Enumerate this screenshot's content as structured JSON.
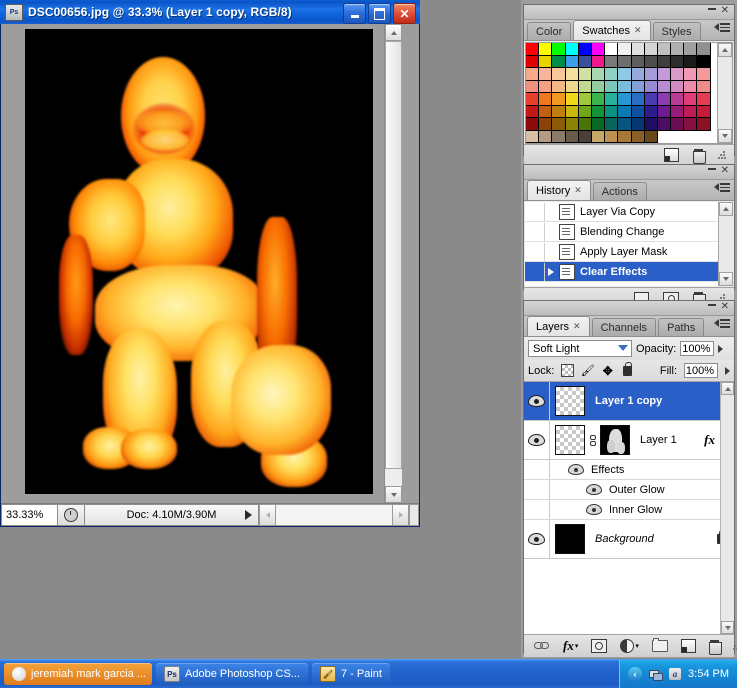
{
  "document_window": {
    "title": "DSC00656.jpg @ 33.3% (Layer 1 copy, RGB/8)",
    "app_icon": "photoshop-icon",
    "minimize_label": "_",
    "maximize_label": "□",
    "close_label": "✕",
    "status": {
      "zoom": "33.33%",
      "doc_info": "Doc: 4.10M/3.90M"
    }
  },
  "swatches_panel": {
    "tabs": [
      {
        "label": "Color",
        "active": false,
        "closable": false
      },
      {
        "label": "Swatches",
        "active": true,
        "closable": true
      },
      {
        "label": "Styles",
        "active": false,
        "closable": false
      }
    ],
    "close_x": "✕",
    "swatch_rows": [
      [
        "#ff0000",
        "#ffff00",
        "#00ff00",
        "#00ffff",
        "#0000ff",
        "#ff00ff",
        "#ffffff",
        "#f0f0f0",
        "#e0e0e0",
        "#d4d4d4",
        "#c0c0c0",
        "#b0b0b0",
        "#a0a0a0",
        "#909090"
      ],
      [
        "#e00000",
        "#e8d400",
        "#008c4a",
        "#3ba0e8",
        "#3a4f9e",
        "#f0188c",
        "#7a7a7a",
        "#6e6e6e",
        "#5e5e5e",
        "#4e4e4e",
        "#3e3e3e",
        "#2e2e2e",
        "#1a1a1a",
        "#000000"
      ],
      [
        "#f8a98a",
        "#f6b49a",
        "#f6c79a",
        "#f3e09c",
        "#cfe0a0",
        "#a8d7b0",
        "#8fd2c4",
        "#8fc8e2",
        "#96aade",
        "#a59bd8",
        "#c39bd8",
        "#d89bc8",
        "#f09ab4",
        "#f29a9a"
      ],
      [
        "#f29080",
        "#f2a184",
        "#f2b884",
        "#eed88c",
        "#c2d88e",
        "#95ce9e",
        "#79c8bb",
        "#79bcdc",
        "#839ed8",
        "#968bd2",
        "#b88bd2",
        "#d28bc0",
        "#ec8aa8",
        "#ee8a8a"
      ],
      [
        "#e8402c",
        "#f07820",
        "#f09820",
        "#f2d81c",
        "#9ec83c",
        "#3cb44c",
        "#28b29a",
        "#2896d2",
        "#2a6ec4",
        "#4a3cb0",
        "#8a3cb0",
        "#b83c96",
        "#e03c78",
        "#e43c52"
      ],
      [
        "#c41818",
        "#c06010",
        "#c08010",
        "#c8b810",
        "#6ea818",
        "#149438",
        "#0c9280",
        "#0c78b4",
        "#1050a4",
        "#2c1c90",
        "#6c1c90",
        "#981c78",
        "#c01c58",
        "#c41c38"
      ],
      [
        "#8c0a0a",
        "#8a4208",
        "#8a5c08",
        "#8c8208",
        "#4a7408",
        "#086824",
        "#066458",
        "#065480",
        "#083874",
        "#1e0e64",
        "#4c0e64",
        "#6c0e54",
        "#88103e",
        "#8c1026"
      ],
      [
        "#d9bfa4",
        "#b49a82",
        "#8a7a68",
        "#6a5a4a",
        "#4a4038",
        "#c8a868",
        "#c09050",
        "#a87838",
        "#8a6028",
        "#6a4818",
        "",
        "",
        "",
        ""
      ]
    ],
    "footer_buttons": [
      "new-swatch-icon",
      "delete-swatch-icon"
    ]
  },
  "history_panel": {
    "tabs": [
      {
        "label": "History",
        "active": true,
        "closable": true
      },
      {
        "label": "Actions",
        "active": false,
        "closable": false
      }
    ],
    "items": [
      {
        "label": "Layer Via Copy",
        "selected": false
      },
      {
        "label": "Blending Change",
        "selected": false
      },
      {
        "label": "Apply Layer Mask",
        "selected": false
      },
      {
        "label": "Clear Effects",
        "selected": true
      }
    ],
    "footer_buttons": [
      "new-document-from-state-icon",
      "new-snapshot-icon",
      "delete-state-icon"
    ]
  },
  "layers_panel": {
    "tabs": [
      {
        "label": "Layers",
        "active": true,
        "closable": true
      },
      {
        "label": "Channels",
        "active": false,
        "closable": false
      },
      {
        "label": "Paths",
        "active": false,
        "closable": false
      }
    ],
    "blend_mode": "Soft Light",
    "opacity_label": "Opacity:",
    "opacity_value": "100%",
    "lock_label": "Lock:",
    "fill_label": "Fill:",
    "fill_value": "100%",
    "lock_icons": [
      "lock-transparent-pixels-icon",
      "lock-image-pixels-icon",
      "lock-position-icon",
      "lock-all-icon"
    ],
    "layers": [
      {
        "name": "Layer 1 copy",
        "selected": true,
        "visible": true,
        "thumb": "checker",
        "has_mask": false,
        "has_fx": false,
        "locked": false,
        "italic": false
      },
      {
        "name": "Layer 1",
        "selected": false,
        "visible": true,
        "thumb": "checker",
        "has_mask": true,
        "has_fx": true,
        "fx_label": "fx",
        "locked": false,
        "italic": false
      }
    ],
    "effects_group": {
      "label": "Effects",
      "items": [
        "Outer Glow",
        "Inner Glow"
      ]
    },
    "background_layer": {
      "name": "Background",
      "visible": true,
      "thumb": "black",
      "locked": true,
      "italic": true
    },
    "footer_buttons": [
      "link-layers-icon",
      "layer-style-fx-icon",
      "add-layer-mask-icon",
      "new-adjustment-layer-icon",
      "new-group-icon",
      "new-layer-icon",
      "delete-layer-icon"
    ]
  },
  "taskbar": {
    "items": [
      {
        "label": "jeremiah mark garcia ...",
        "icon": "browser-icon",
        "active": true
      },
      {
        "label": "Adobe Photoshop CS...",
        "icon": "photoshop-icon",
        "active": false
      },
      {
        "label": "7 - Paint",
        "icon": "paint-icon",
        "active": false
      }
    ],
    "tray": {
      "icons": [
        "show-hidden-icons-arrow",
        "network-icon",
        "messenger-icon"
      ],
      "time": "3:54 PM"
    }
  },
  "canvas": {
    "description": "thermal-inverted photograph of a crouching figure on black background",
    "background_color": "#000000"
  }
}
